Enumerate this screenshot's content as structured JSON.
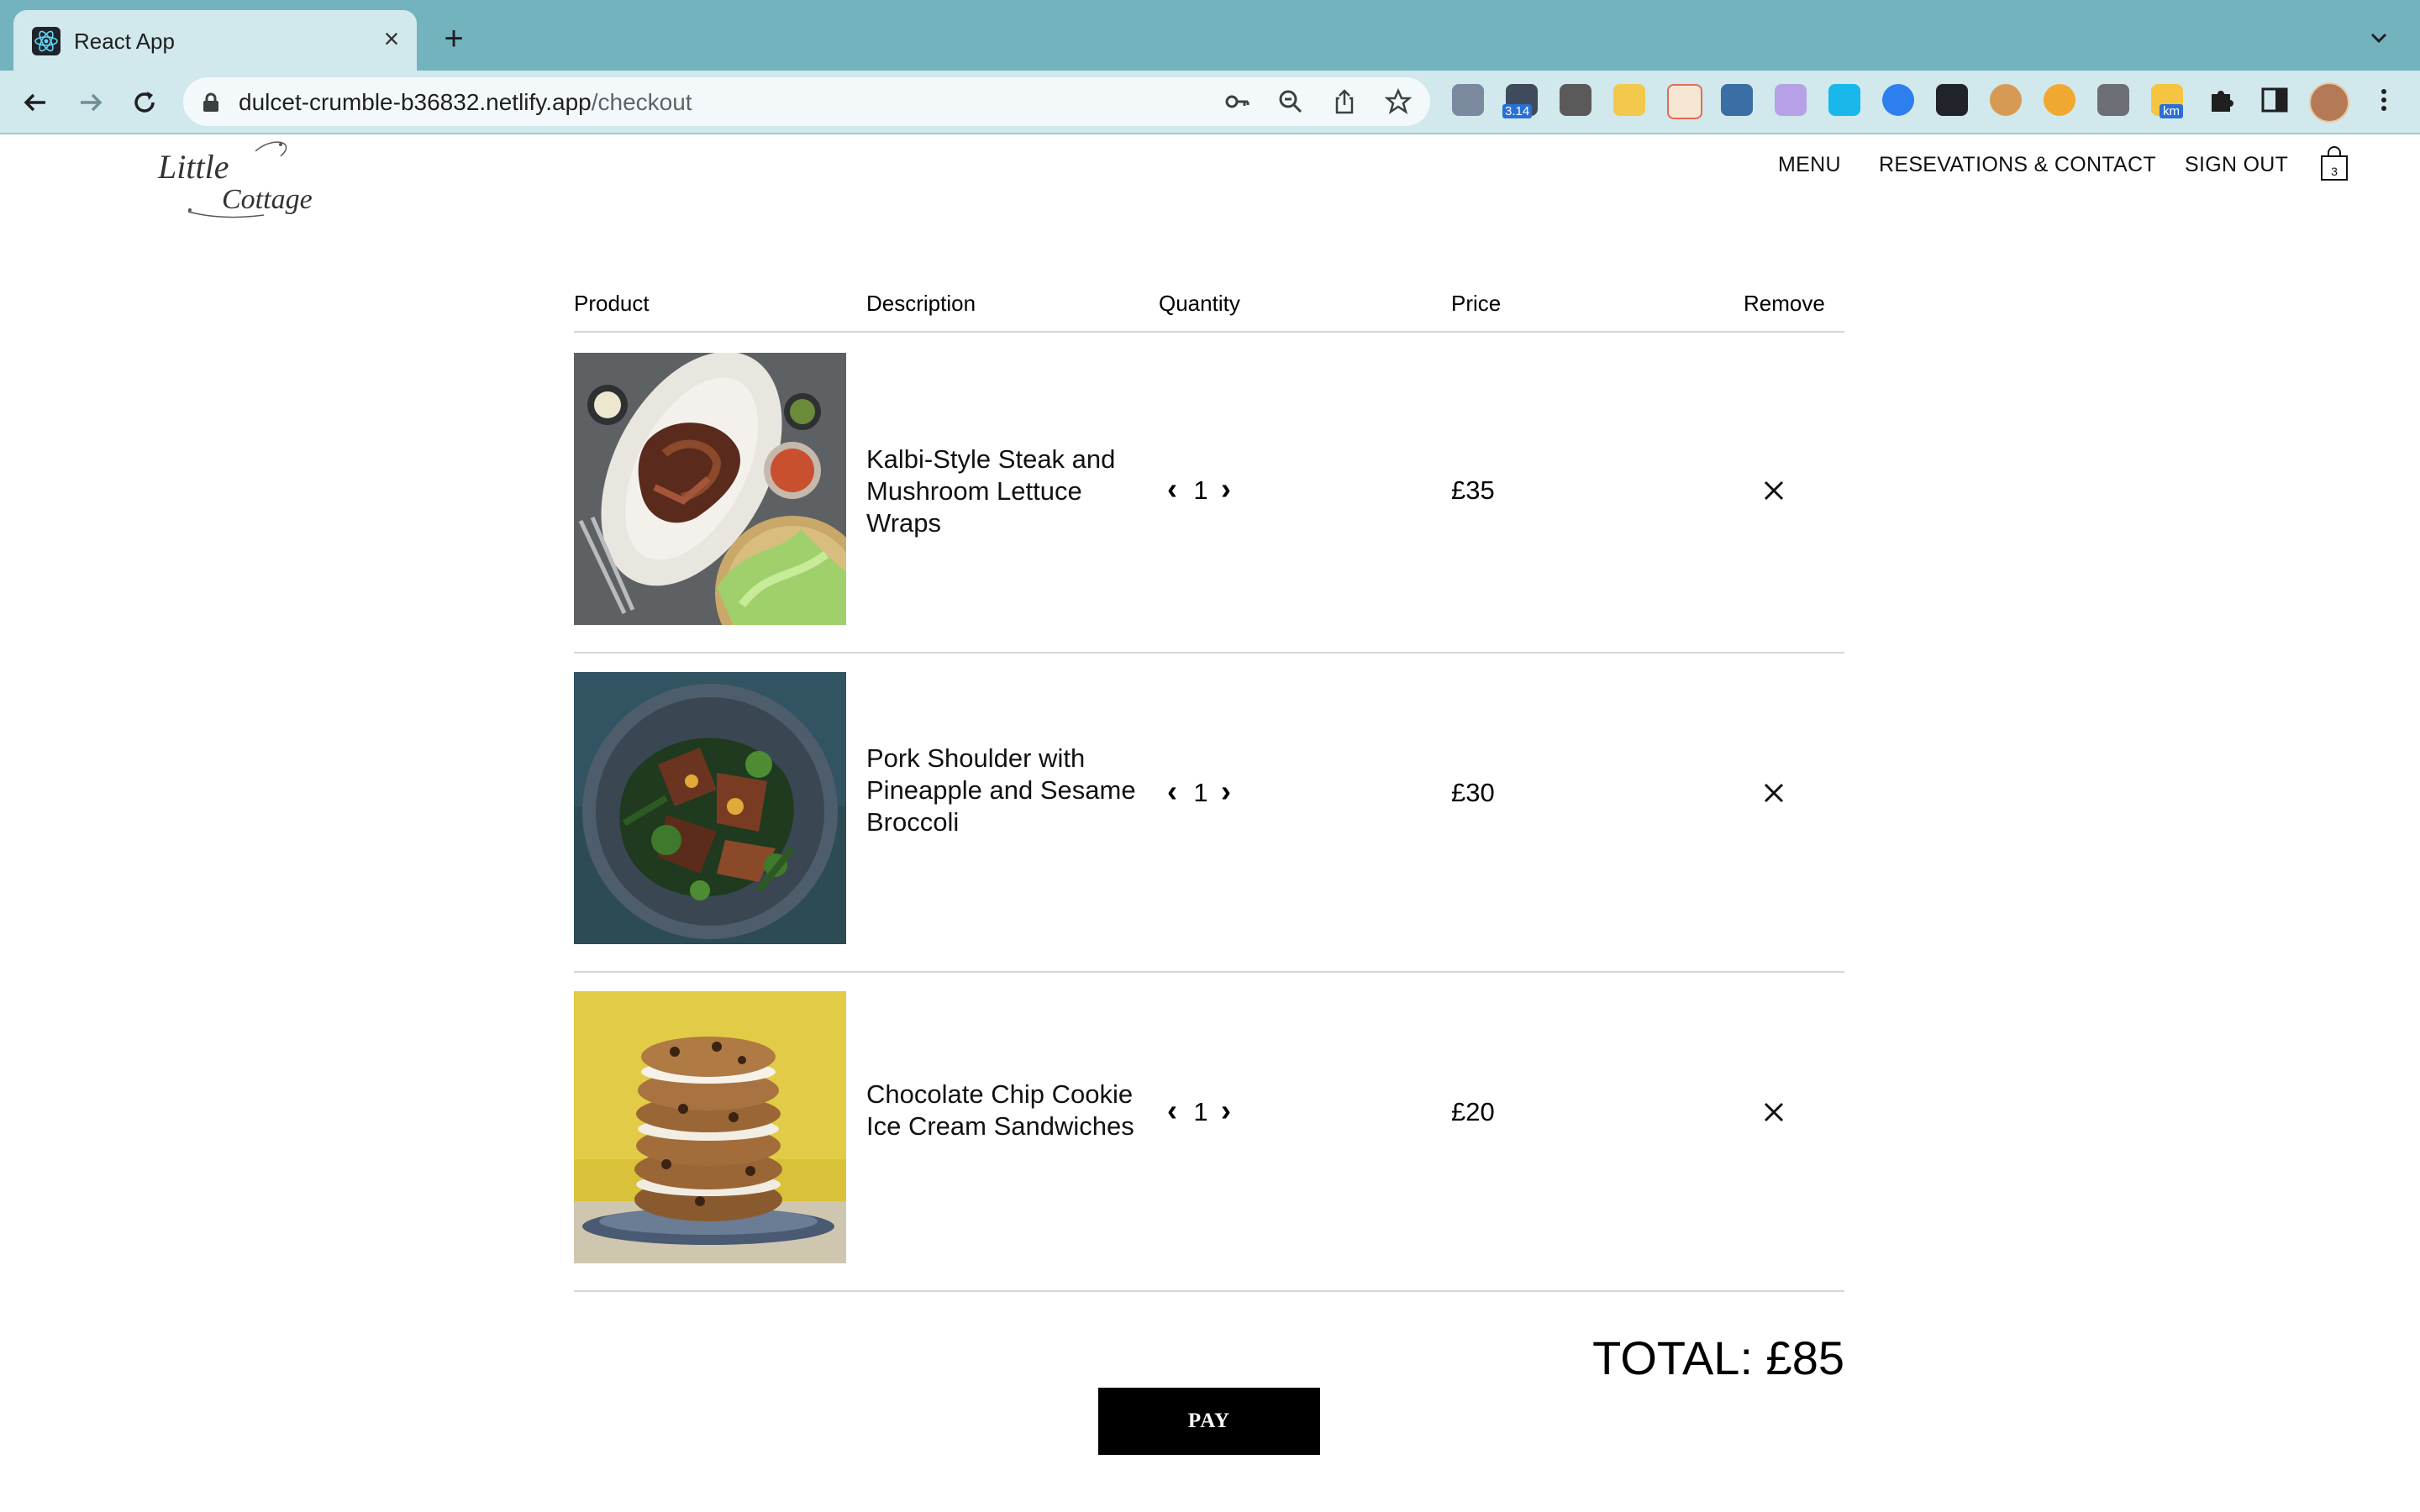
{
  "browser": {
    "tab_title": "React App",
    "url_host": "dulcet-crumble-b36832.netlify.app",
    "url_path": "/checkout",
    "extension_badges": {
      "badge_a": "3.14",
      "badge_b": "km"
    }
  },
  "header": {
    "logo_text_line1": "Little",
    "logo_text_line2": "Cottage",
    "nav": [
      "MENU",
      "RESEVATIONS & CONTACT",
      "SIGN OUT"
    ],
    "cart_count": "3"
  },
  "table": {
    "headers": [
      "Product",
      "Description",
      "Quantity",
      "Price",
      "Remove"
    ],
    "rows": [
      {
        "description": [
          "Kalbi-Style Steak and",
          "Mushroom Lettuce",
          "Wraps"
        ],
        "quantity": "1",
        "price": "£35",
        "image": "steak-lettuce-wraps"
      },
      {
        "description": [
          "Pork Shoulder with",
          "Pineapple and Sesame",
          "Broccoli"
        ],
        "quantity": "1",
        "price": "£30",
        "image": "pork-shoulder-broccoli"
      },
      {
        "description": [
          "Chocolate Chip Cookie",
          "Ice Cream Sandwiches"
        ],
        "quantity": "1",
        "price": "£20",
        "image": "cookie-ice-cream-sandwiches"
      }
    ]
  },
  "total": "TOTAL: £85",
  "pay_label": "PAY",
  "icons": {
    "decrease": "chevron-left-icon",
    "increase": "chevron-right-icon",
    "remove": "close-icon"
  },
  "colors": {
    "tabstrip": "#72b3bd",
    "toolbar": "#d1e8ec",
    "pay_button": "#000000",
    "divider": "#d6d6d6"
  }
}
